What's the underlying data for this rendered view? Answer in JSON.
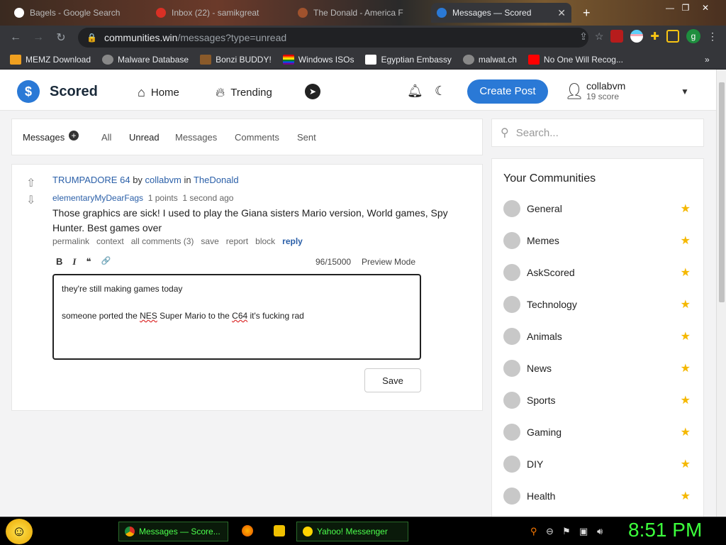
{
  "browser": {
    "tabs": [
      {
        "label": "Bagels - Google Search",
        "active": false
      },
      {
        "label": "Inbox (22) - samikgreat",
        "active": false
      },
      {
        "label": "The Donald - America F",
        "active": false
      },
      {
        "label": "Messages — Scored",
        "active": true
      }
    ],
    "new_tab": "+",
    "url_host": "communities.win",
    "url_path": "/messages?type=unread",
    "bookmarks": [
      {
        "label": "MEMZ Download",
        "color": "#f0a020"
      },
      {
        "label": "Malware Database",
        "color": "#888888"
      },
      {
        "label": "Bonzi BUDDY!",
        "color": "#8a5a2a"
      },
      {
        "label": "Windows ISOs",
        "color": "#e04040"
      },
      {
        "label": "Egyptian Embassy",
        "color": "#ffffff"
      },
      {
        "label": "malwat.ch",
        "color": "#888888"
      },
      {
        "label": "No One Will Recog...",
        "color": "#ff0000"
      }
    ],
    "more_bookmarks": "»",
    "profile_initial": "g"
  },
  "header": {
    "logo_letter": "$",
    "logo_text": "Scored",
    "home": "Home",
    "trending": "Trending",
    "create_post": "Create Post",
    "username": "collabvm",
    "score": "19 score"
  },
  "messages_tabs": {
    "title": "Messages",
    "all": "All",
    "unread": "Unread",
    "messages": "Messages",
    "comments": "Comments",
    "sent": "Sent"
  },
  "search": {
    "placeholder": "Search..."
  },
  "comment": {
    "post_title": "TRUMPADORE 64",
    "by": "by",
    "post_author": "collabvm",
    "in": "in",
    "community": "TheDonald",
    "author": "elementaryMyDearFags",
    "points": "1 points",
    "time": "1 second ago",
    "body": "Those graphics are sick! I used to play the Giana sisters Mario version, World games, Spy Hunter. Best games over",
    "actions": {
      "permalink": "permalink",
      "context": "context",
      "all_comments": "all comments (3)",
      "save": "save",
      "report": "report",
      "block": "block",
      "reply": "reply"
    }
  },
  "editor": {
    "bold": "B",
    "italic": "I",
    "quote": "❝",
    "link": "🔗",
    "counter": "96/15000",
    "preview": "Preview Mode",
    "line1": "they're still making games today",
    "line2_a": "someone ported the ",
    "line2_b": "NES",
    "line2_c": " Super Mario to the ",
    "line2_d": "C64",
    "line2_e": " it's fucking rad",
    "save": "Save"
  },
  "sidebar": {
    "title": "Your Communities",
    "communities": [
      "General",
      "Memes",
      "AskScored",
      "Technology",
      "Animals",
      "News",
      "Sports",
      "Gaming",
      "DIY",
      "Health"
    ]
  },
  "taskbar": {
    "task1": "Messages — Score...",
    "task2": "Yahoo! Messenger",
    "clock": "8:51 PM"
  }
}
